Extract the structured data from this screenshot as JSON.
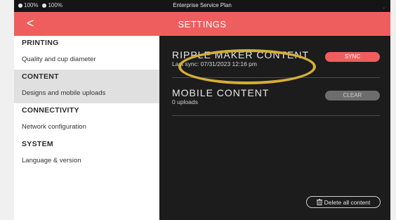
{
  "status_bar": {
    "battery_1": "100%",
    "battery_2": "100%",
    "center_text": "Enterprise Service Plan",
    "right_text": "."
  },
  "header": {
    "back_icon": "chevron-left-icon",
    "back_glyph": "<",
    "title": "SETTINGS"
  },
  "sidebar": {
    "sections": [
      {
        "heading": "PRINTING",
        "item": "Quality and cup diameter"
      },
      {
        "heading": "CONTENT",
        "item": "Designs and mobile uploads"
      },
      {
        "heading": "CONNECTIVITY",
        "item": "Network configuration"
      },
      {
        "heading": "SYSTEM",
        "item": "Language & version"
      }
    ]
  },
  "main": {
    "ripple": {
      "title": "RIPPLE MAKER CONTENT",
      "subtitle": "Last sync: 07/31/2023 12:16 pm",
      "button": "SYNC"
    },
    "mobile": {
      "title": "MOBILE CONTENT",
      "subtitle": "0 uploads",
      "button": "CLEAR"
    },
    "delete_all": "Delete all content"
  },
  "colors": {
    "accent": "#ef5e5e",
    "highlight": "#d4af37",
    "panel_bg": "#1c1c1c"
  }
}
